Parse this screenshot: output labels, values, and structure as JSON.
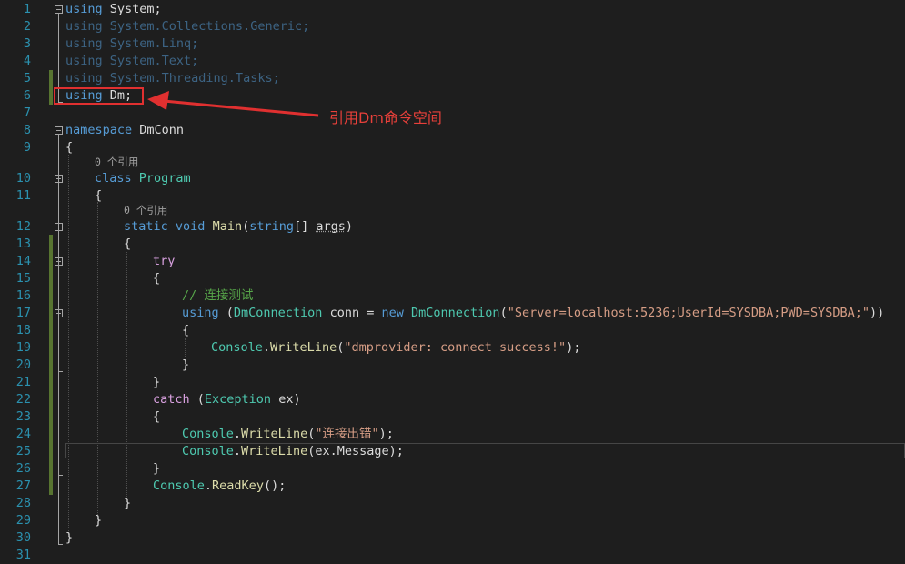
{
  "editor": {
    "line_numbers": [
      "1",
      "2",
      "3",
      "4",
      "5",
      "6",
      "7",
      "8",
      "9",
      "10",
      "11",
      "12",
      "13",
      "14",
      "15",
      "16",
      "17",
      "18",
      "19",
      "20",
      "21",
      "22",
      "23",
      "24",
      "25",
      "26",
      "27",
      "28",
      "29",
      "30",
      "31"
    ],
    "codelens_refs": "0 个引用",
    "code": {
      "l1_kw": "using",
      "l1_rest": " System;",
      "l2": "using System.Collections.Generic;",
      "l3": "using System.Linq;",
      "l4": "using System.Text;",
      "l5": "using System.Threading.Tasks;",
      "l6_kw": "using",
      "l6_rest": " Dm;",
      "l8_kw": "namespace",
      "l8_rest": " DmConn",
      "open_brace": "{",
      "close_brace": "}",
      "l10_kw": "class",
      "l10_type": "Program",
      "l12_kw1": "static",
      "l12_kw2": "void",
      "l12_fn": "Main",
      "l12_p1": "(",
      "l12_kw3": "string",
      "l12_p2": "[] ",
      "l12_arg": "args",
      "l12_p3": ")",
      "l14_kw": "try",
      "l16_comment": "// 连接测试",
      "l17_kw": "using",
      "l17_p1": " (",
      "l17_type1": "DmConnection",
      "l17_p2": " conn = ",
      "l17_kw2": "new",
      "l17_type2": "DmConnection",
      "l17_p3": "(",
      "l17_str": "\"Server=localhost:5236;UserId=SYSDBA;PWD=SYSDBA;\"",
      "l17_p4": "))",
      "l19_type": "Console",
      "l19_dot": ".",
      "l19_fn": "WriteLine",
      "l19_p1": "(",
      "l19_str": "\"dmprovider: connect success!\"",
      "l19_p2": ");",
      "l22_kw": "catch",
      "l22_p1": " (",
      "l22_type": "Exception",
      "l22_p2": " ex)",
      "l24_type": "Console",
      "l24_dot": ".",
      "l24_fn": "WriteLine",
      "l24_p1": "(",
      "l24_str": "\"连接出错\"",
      "l24_p2": ");",
      "l25_type": "Console",
      "l25_dot": ".",
      "l25_fn": "WriteLine",
      "l25_p1": "(ex.Message);",
      "l27_type": "Console",
      "l27_dot": ".",
      "l27_fn": "ReadKey",
      "l27_p1": "();"
    }
  },
  "annotation": {
    "text": "引用Dm命令空间",
    "color": "#e8403a"
  },
  "colors": {
    "background": "#1e1e1e",
    "keyword": "#569cd6",
    "control": "#d8a0df",
    "type": "#4ec9b0",
    "method": "#dcdcaa",
    "string": "#d69d85",
    "comment": "#57a64a",
    "line_number": "#2b91af"
  }
}
